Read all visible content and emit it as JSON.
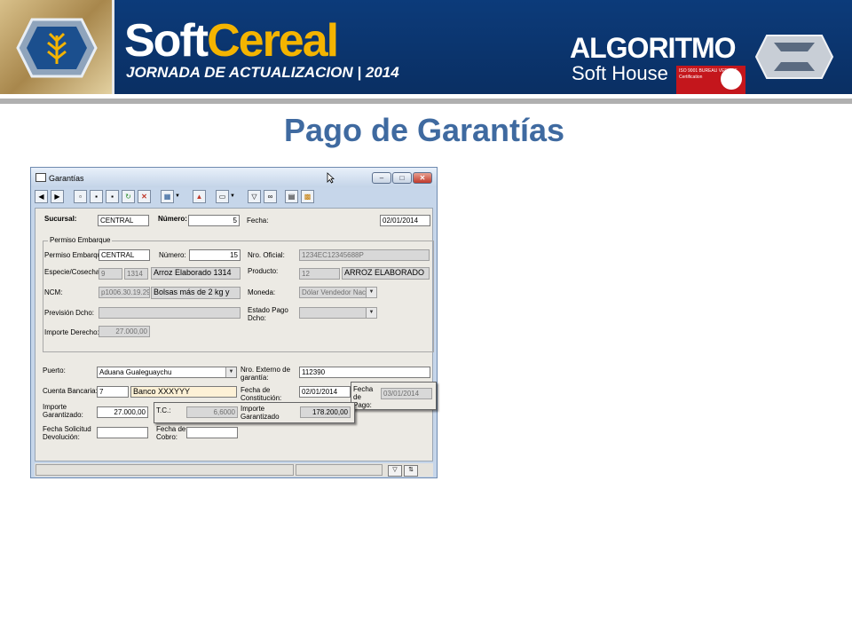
{
  "banner": {
    "brand_soft": "Soft",
    "brand_cereal": "Cereal",
    "event_subtitle": "JORNADA DE ACTUALIZACION | 2014",
    "company_name": "ALGORITMO",
    "company_sub": "Soft House",
    "certification": "ISO 9001 BUREAU VERITAS Certification"
  },
  "slide": {
    "title": "Pago de Garantías"
  },
  "window": {
    "title": "Garantías",
    "buttons": {
      "minimize": "–",
      "maximize": "□",
      "close": "✕"
    }
  },
  "toolbar": {
    "icons": [
      "arrow-left-icon",
      "arrow-right-icon",
      "new-document-icon",
      "save-icon",
      "save-as-icon",
      "refresh-icon",
      "delete-icon",
      "grid-icon",
      "print-icon",
      "window-icon",
      "filter-icon",
      "binoculars-icon",
      "calculator-icon",
      "palette-icon"
    ]
  },
  "header": {
    "sucursal_label": "Sucursal:",
    "sucursal_value": "CENTRAL",
    "numero_label": "Número:",
    "numero_value": "5",
    "fecha_label": "Fecha:",
    "fecha_value": "02/01/2014"
  },
  "permiso": {
    "group_title": "Permiso Embarque",
    "permiso_label": "Permiso Embarque:",
    "permiso_value": "CENTRAL",
    "numero_label": "Número:",
    "numero_value": "15",
    "nro_oficial_label": "Nro. Oficial:",
    "nro_oficial_value": "1234EC12345688P",
    "especie_label": "Especie/Cosecha:",
    "especie_code": "9",
    "cosecha_code": "1314",
    "especie_desc": "Arroz Elaborado 1314",
    "producto_label": "Producto:",
    "producto_code": "12",
    "producto_desc": "ARROZ ELABORADO",
    "ncm_label": "NCM:",
    "ncm_code": "p1006.30.19.29",
    "ncm_desc": "Bolsas más de 2 kg y",
    "moneda_label": "Moneda:",
    "moneda_value": "Dólar Vendedor Naci",
    "prevision_label": "Previsión Dcho:",
    "estado_label": "Estado Pago Dcho:",
    "importe_label": "Importe Derecho:",
    "importe_value": "27.000,00"
  },
  "detalle": {
    "puerto_label": "Puerto:",
    "puerto_value": "Aduana Gualeguaychu",
    "nro_externo_label": "Nro. Externo de garantía:",
    "nro_externo_value": "112390",
    "cuenta_label": "Cuenta Bancaria:",
    "cuenta_code": "7",
    "cuenta_desc": "Banco XXXYYY",
    "fecha_const_label": "Fecha de Constitución:",
    "fecha_const_value": "02/01/2014",
    "fecha_pago_label": "Fecha de Pago:",
    "fecha_pago_value": "03/01/2014",
    "importe_gar_label": "Importe Garantizado:",
    "importe_gar_value": "27.000,00",
    "tc_label": "T.C.:",
    "tc_value": "6,6000",
    "importe_pesos_label": "Importe Garantizado Pesos:",
    "importe_pesos_value": "178.200,00",
    "fecha_sol_label": "Fecha Solicitud Devolución:",
    "fecha_cobro_label": "Fecha de Cobro:"
  },
  "colors": {
    "title": "#3f6aa0",
    "banner": "#0c3b7a",
    "brand_accent": "#f4b400",
    "window_frame": "#c6d6ea"
  }
}
